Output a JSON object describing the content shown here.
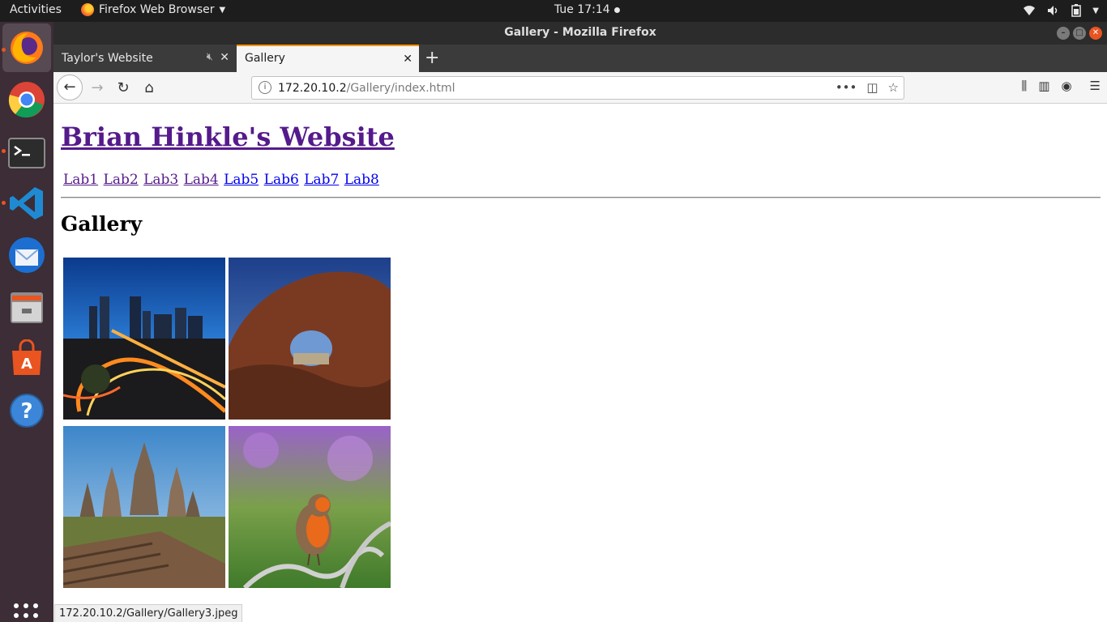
{
  "topbar": {
    "activities": "Activities",
    "app_menu": "Firefox Web Browser",
    "clock": "Tue 17:14"
  },
  "dock": {
    "items": [
      {
        "name": "Firefox",
        "icon": "firefox-icon"
      },
      {
        "name": "Chrome",
        "icon": "chrome-icon"
      },
      {
        "name": "Terminal",
        "icon": "terminal-icon"
      },
      {
        "name": "Visual Studio Code",
        "icon": "vscode-icon"
      },
      {
        "name": "Thunderbird",
        "icon": "thunderbird-icon"
      },
      {
        "name": "Files",
        "icon": "files-icon"
      },
      {
        "name": "Ubuntu Software",
        "icon": "software-icon"
      },
      {
        "name": "Help",
        "icon": "help-icon"
      }
    ]
  },
  "window": {
    "title": "Gallery - Mozilla Firefox"
  },
  "tabs": [
    {
      "label": "Taylor's Website"
    },
    {
      "label": "Gallery"
    }
  ],
  "urlbar": {
    "host": "172.20.10.2",
    "path": "/Gallery/index.html"
  },
  "page": {
    "site_title": "Brian Hinkle's Website",
    "nav_links": [
      "Lab1",
      "Lab2",
      "Lab3",
      "Lab4",
      "Lab5",
      "Lab6",
      "Lab7",
      "Lab8"
    ],
    "heading": "Gallery"
  },
  "statusbar": {
    "text": "172.20.10.2/Gallery/Gallery3.jpeg"
  },
  "colors": {
    "visited_link": "#551a8b",
    "unvisited_link": "#0000ee",
    "dock_bg": "#3c2d36",
    "accent": "#e95420"
  }
}
